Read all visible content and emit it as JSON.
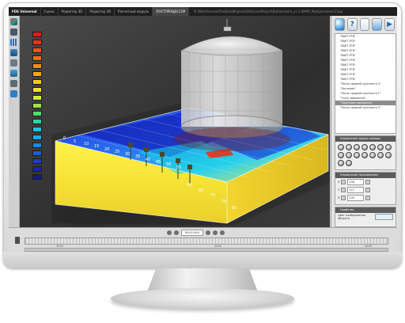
{
  "window": {
    "tabs": [
      "FDS Universal",
      "Сцена",
      "Редактор 3D",
      "Редактор 3D",
      "Расчетный модуль",
      "ПОСТПРОЦЕССОР"
    ],
    "active_tab_index": 5,
    "path": "D:\\Work\\Unreal\\Fire\\DataProjects\\Stations\\Project\\Stationroom_cs.1.SMAP_Postprocessor\\1\\log"
  },
  "left_toolbar": {
    "icons": [
      "palette-icon",
      "wrench-icon",
      "grid-icon",
      "layers-icon",
      "measure-icon",
      "camera-icon",
      "settings-icon",
      "info-icon"
    ]
  },
  "viewport": {
    "scale_colors": [
      "#e31a1c",
      "#e8321c",
      "#f0511a",
      "#f26b18",
      "#f68a14",
      "#f8a816",
      "#f4c81d",
      "#efe226",
      "#d4ee2f",
      "#9ce345",
      "#59d766",
      "#2fd0a4",
      "#22c4d8",
      "#1fa9e8",
      "#1f85e6",
      "#1c5fd9",
      "#1a3dc6",
      "#1824ae",
      "#141a92"
    ],
    "axis_ticks": [
      "0",
      "5",
      "10",
      "15",
      "20",
      "25",
      "30",
      "35",
      "40",
      "45",
      "50",
      "55",
      "60",
      "65",
      "70",
      "75",
      "80"
    ]
  },
  "right_panel": {
    "toolbar_icons": [
      "color-scale-icon",
      "help-icon",
      "document-icon",
      "image-icon",
      "play-icon"
    ],
    "layers": [
      "\"ВАКТ-РГВ\"",
      "\"ВАКТ-РГВ\"",
      "\"ВАКТ-РГВ\"",
      "\"ВАКТ-РГВ\"",
      "\"ВАКТ-РГВ\"",
      "\"ВАКТ-РГВ\"",
      "\"ВАКТ-РГВ\"",
      "\"ВАКТ-РГВ\"",
      "\"ВАКТ-РГВ\"",
      "\"ВАКТ-РГВ\"",
      "\"Песок средней крупности 2\"",
      "\"Песчаник\"",
      "\"Песок средней крупности 1\"",
      "\"Грунт вмещения\"",
      "\"Подпочвен вмещения\"",
      "\"Песок средней крупности 3\""
    ],
    "selected_layer_index": 14,
    "camera_header": "Управление видом камеры",
    "position_header": "Управление положением",
    "fields": [
      {
        "label": "X",
        "value": "206"
      },
      {
        "label": "Y",
        "value": "112"
      },
      {
        "label": "Z",
        "value": "140"
      }
    ],
    "properties_header": "Свойства",
    "property_label": "Цвет изображения объекта",
    "property_value": ""
  },
  "bottom_bar": {
    "time_value": "00:01:00:0",
    "timeline_labels": [
      "2016",
      "2016",
      "2016"
    ]
  }
}
